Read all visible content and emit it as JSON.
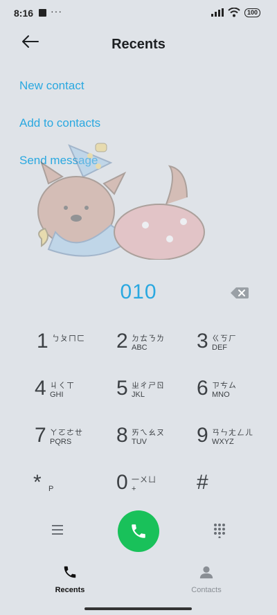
{
  "status_bar": {
    "time": "8:16",
    "dots": "···",
    "battery": "100"
  },
  "header": {
    "title": "Recents",
    "back_icon": "arrow-left-icon"
  },
  "actions": [
    {
      "label": "New contact"
    },
    {
      "label": "Add to contacts"
    },
    {
      "label": "Send message"
    }
  ],
  "dialer": {
    "number": "010"
  },
  "keys": [
    {
      "digit": "1",
      "bopo": "ㄅㄆㄇㄈ",
      "letters": ""
    },
    {
      "digit": "2",
      "bopo": "ㄉㄊㄋㄌ",
      "letters": "ABC"
    },
    {
      "digit": "3",
      "bopo": "ㄍㄎㄏ",
      "letters": "DEF"
    },
    {
      "digit": "4",
      "bopo": "ㄐㄑㄒ",
      "letters": "GHI"
    },
    {
      "digit": "5",
      "bopo": "ㄓㄔㄕㄖ",
      "letters": "JKL"
    },
    {
      "digit": "6",
      "bopo": "ㄗㄘㄙ",
      "letters": "MNO"
    },
    {
      "digit": "7",
      "bopo": "ㄚㄛㄜㄝ",
      "letters": "PQRS"
    },
    {
      "digit": "8",
      "bopo": "ㄞㄟㄠㄡ",
      "letters": "TUV"
    },
    {
      "digit": "9",
      "bopo": "ㄢㄣㄤㄥㄦ",
      "letters": "WXYZ"
    },
    {
      "digit": "*",
      "bopo": "",
      "letters": "P"
    },
    {
      "digit": "0",
      "bopo": "一ㄨㄩ",
      "letters": "+"
    },
    {
      "digit": "#",
      "bopo": "",
      "letters": ""
    }
  ],
  "tabs": [
    {
      "label": "Recents",
      "active": true
    },
    {
      "label": "Contacts",
      "active": false
    }
  ],
  "colors": {
    "accent": "#2aa8e0",
    "call": "#19c15a",
    "background": "#dfe3e8"
  }
}
